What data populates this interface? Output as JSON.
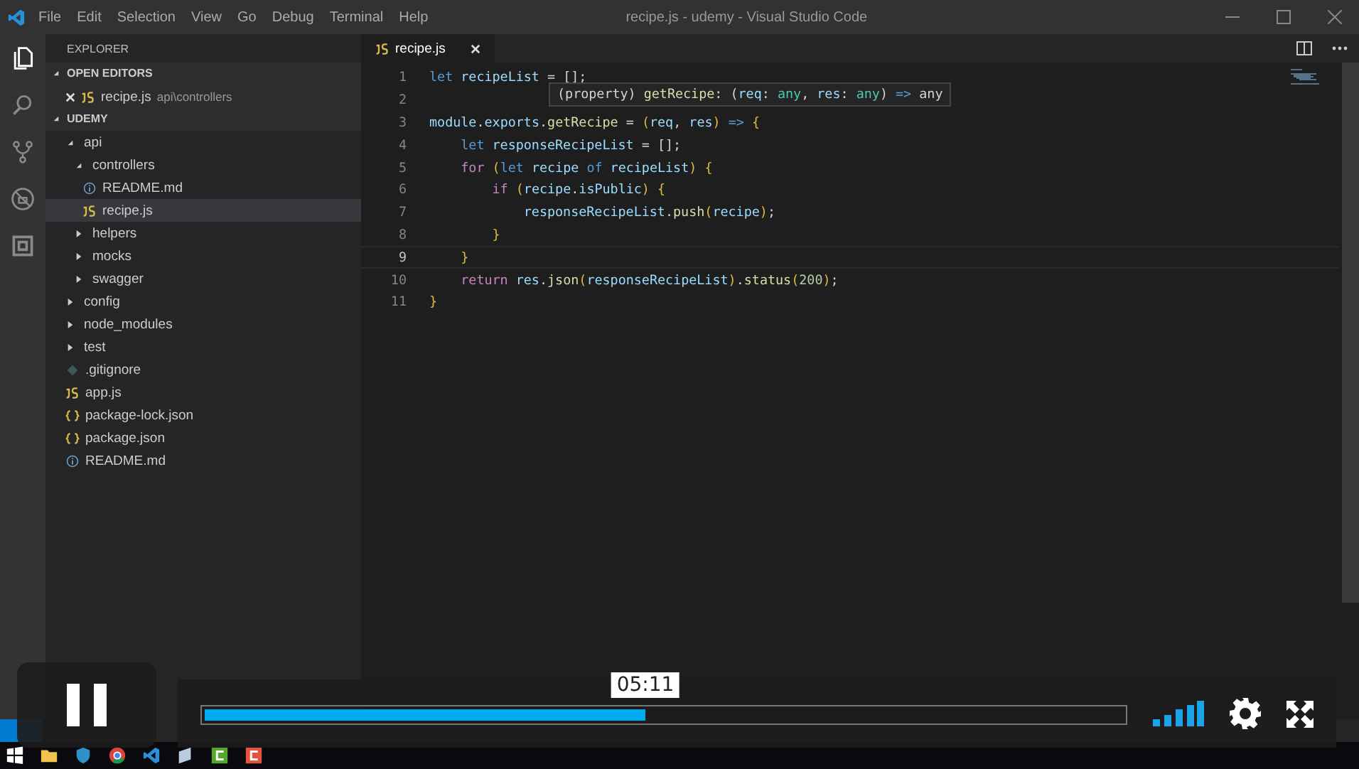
{
  "window": {
    "title": "recipe.js - udemy - Visual Studio Code"
  },
  "menu": [
    "File",
    "Edit",
    "Selection",
    "View",
    "Go",
    "Debug",
    "Terminal",
    "Help"
  ],
  "activity_bar": [
    {
      "kind": "files",
      "selected": true
    },
    {
      "kind": "search",
      "selected": false
    },
    {
      "kind": "git",
      "selected": false
    },
    {
      "kind": "debug",
      "selected": false
    },
    {
      "kind": "extensions",
      "selected": false
    }
  ],
  "sidebar": {
    "title": "EXPLORER",
    "open_editors": {
      "label": "OPEN EDITORS",
      "expanded": true,
      "items": [
        {
          "name": "recipe.js",
          "path": "api\\controllers",
          "kind": "js"
        }
      ]
    },
    "project": {
      "label": "UDEMY",
      "expanded": true,
      "items": [
        {
          "name": "api",
          "kind": "folder",
          "expanded": true,
          "selected": false,
          "children": [
            {
              "name": "controllers",
              "kind": "folder",
              "expanded": true,
              "selected": false,
              "children": [
                {
                  "name": "README.md",
                  "kind": "info",
                  "selected": false
                },
                {
                  "name": "recipe.js",
                  "kind": "js",
                  "selected": true
                }
              ]
            },
            {
              "name": "helpers",
              "kind": "folder",
              "expanded": false,
              "selected": false
            },
            {
              "name": "mocks",
              "kind": "folder",
              "expanded": false,
              "selected": false
            },
            {
              "name": "swagger",
              "kind": "folder",
              "expanded": false,
              "selected": false
            }
          ]
        },
        {
          "name": "config",
          "kind": "folder",
          "expanded": false,
          "selected": false
        },
        {
          "name": "node_modules",
          "kind": "folder",
          "expanded": false,
          "selected": false
        },
        {
          "name": "test",
          "kind": "folder",
          "expanded": false,
          "selected": false
        },
        {
          "name": ".gitignore",
          "kind": "git",
          "selected": false
        },
        {
          "name": "app.js",
          "kind": "js",
          "selected": false
        },
        {
          "name": "package-lock.json",
          "kind": "json",
          "selected": false
        },
        {
          "name": "package.json",
          "kind": "json",
          "selected": false
        },
        {
          "name": "README.md",
          "kind": "info",
          "selected": false
        }
      ]
    }
  },
  "tabs": [
    {
      "label": "recipe.js",
      "kind": "js",
      "selected": true
    }
  ],
  "code": [
    {
      "number": "1",
      "current": false,
      "tokens": [
        {
          "text": "let ",
          "kind": "keyword"
        },
        {
          "text": "recipeList",
          "kind": "variable"
        },
        {
          "text": " = ",
          "kind": "plain"
        },
        {
          "text": "[];",
          "kind": "plain"
        }
      ]
    },
    {
      "number": "2",
      "current": false
    },
    {
      "number": "3",
      "current": false,
      "tokens": [
        {
          "text": "module",
          "kind": "variable"
        },
        {
          "text": ".",
          "kind": "plain"
        },
        {
          "text": "exports",
          "kind": "variable"
        },
        {
          "text": ".",
          "kind": "plain"
        },
        {
          "text": "getRecipe",
          "kind": "function"
        },
        {
          "text": " = ",
          "kind": "plain"
        },
        {
          "text": "(",
          "kind": "bracket"
        },
        {
          "text": "req",
          "kind": "variable"
        },
        {
          "text": ", ",
          "kind": "plain"
        },
        {
          "text": "res",
          "kind": "variable"
        },
        {
          "text": ")",
          "kind": "bracket"
        },
        {
          "text": " => ",
          "kind": "keyword"
        },
        {
          "text": "{",
          "kind": "bracket"
        }
      ]
    },
    {
      "number": "4",
      "current": false,
      "tokens": [
        {
          "text": "    let ",
          "kind": "keyword"
        },
        {
          "text": "responseRecipeList",
          "kind": "variable"
        },
        {
          "text": " = ",
          "kind": "plain"
        },
        {
          "text": "[];",
          "kind": "plain"
        }
      ]
    },
    {
      "number": "5",
      "current": false,
      "tokens": [
        {
          "text": "    for ",
          "kind": "control"
        },
        {
          "text": "(",
          "kind": "bracket"
        },
        {
          "text": "let ",
          "kind": "keyword"
        },
        {
          "text": "recipe ",
          "kind": "variable"
        },
        {
          "text": "of ",
          "kind": "keyword"
        },
        {
          "text": "recipeList",
          "kind": "variable"
        },
        {
          "text": ") ",
          "kind": "bracket"
        },
        {
          "text": "{",
          "kind": "bracket"
        }
      ]
    },
    {
      "number": "6",
      "current": false,
      "tokens": [
        {
          "text": "        if ",
          "kind": "control"
        },
        {
          "text": "(",
          "kind": "bracket"
        },
        {
          "text": "recipe",
          "kind": "variable"
        },
        {
          "text": ".",
          "kind": "plain"
        },
        {
          "text": "isPublic",
          "kind": "variable"
        },
        {
          "text": ") {",
          "kind": "bracket"
        }
      ]
    },
    {
      "number": "7",
      "current": false,
      "tokens": [
        {
          "text": "            responseRecipeList",
          "kind": "variable"
        },
        {
          "text": ".",
          "kind": "plain"
        },
        {
          "text": "push",
          "kind": "function"
        },
        {
          "text": "(",
          "kind": "bracket"
        },
        {
          "text": "recipe",
          "kind": "variable"
        },
        {
          "text": ")",
          "kind": "bracket"
        },
        {
          "text": ";",
          "kind": "plain"
        }
      ]
    },
    {
      "number": "8",
      "current": false,
      "tokens": [
        {
          "text": "        }",
          "kind": "bracket"
        }
      ]
    },
    {
      "number": "9",
      "current": true,
      "tokens": [
        {
          "text": "    }",
          "kind": "bracket"
        }
      ]
    },
    {
      "number": "10",
      "current": false,
      "tokens": [
        {
          "text": "    return ",
          "kind": "control"
        },
        {
          "text": "res",
          "kind": "variable"
        },
        {
          "text": ".",
          "kind": "plain"
        },
        {
          "text": "json",
          "kind": "function"
        },
        {
          "text": "(",
          "kind": "bracket"
        },
        {
          "text": "responseRecipeList",
          "kind": "variable"
        },
        {
          "text": ")",
          "kind": "bracket"
        },
        {
          "text": ".",
          "kind": "plain"
        },
        {
          "text": "status",
          "kind": "function"
        },
        {
          "text": "(",
          "kind": "bracket"
        },
        {
          "text": "200",
          "kind": "number"
        },
        {
          "text": ")",
          "kind": "bracket"
        },
        {
          "text": ";",
          "kind": "plain"
        }
      ]
    },
    {
      "number": "11",
      "current": false,
      "tokens": [
        {
          "text": "}",
          "kind": "bracket"
        }
      ]
    }
  ],
  "hover": {
    "tokens": [
      {
        "text": "(property) ",
        "kind": "plain"
      },
      {
        "text": "getRecipe",
        "kind": "function"
      },
      {
        "text": ": (",
        "kind": "plain"
      },
      {
        "text": "req",
        "kind": "variable"
      },
      {
        "text": ": ",
        "kind": "plain"
      },
      {
        "text": "any",
        "kind": "type"
      },
      {
        "text": ", ",
        "kind": "plain"
      },
      {
        "text": "res",
        "kind": "variable"
      },
      {
        "text": ": ",
        "kind": "plain"
      },
      {
        "text": "any",
        "kind": "type"
      },
      {
        "text": ") ",
        "kind": "plain"
      },
      {
        "text": "=>",
        "kind": "keyword"
      },
      {
        "text": " any",
        "kind": "plain"
      }
    ]
  },
  "player": {
    "playing": true,
    "level": 0.48,
    "time": "05:11"
  },
  "taskbar": [
    {
      "kind": "start"
    },
    {
      "kind": "folder"
    },
    {
      "kind": "shield"
    },
    {
      "kind": "browser"
    },
    {
      "kind": "code"
    },
    {
      "kind": "window"
    },
    {
      "kind": "green-app"
    },
    {
      "kind": "red-app"
    }
  ]
}
